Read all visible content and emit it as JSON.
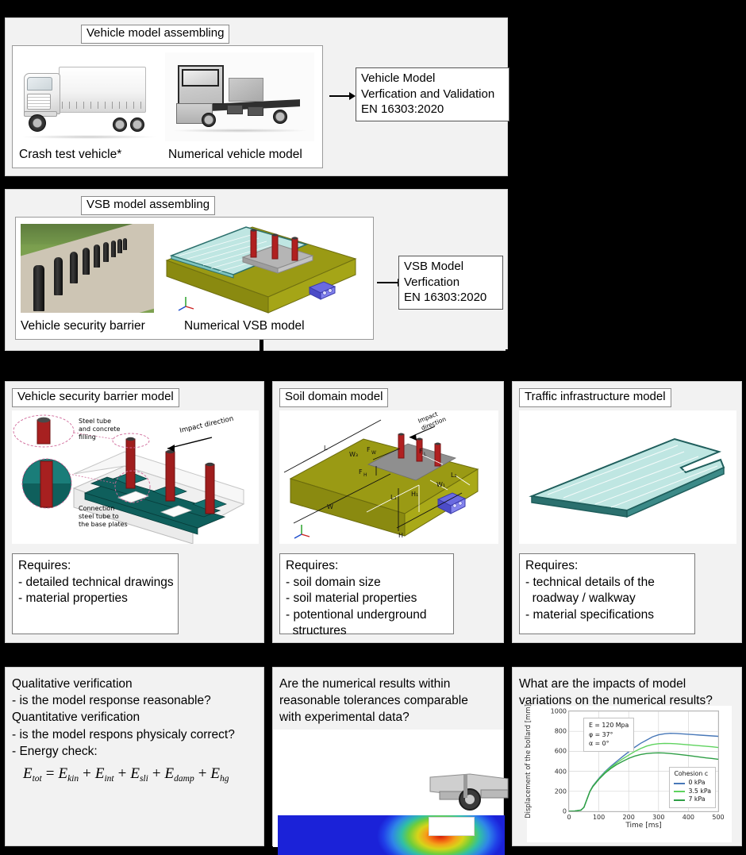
{
  "row1": {
    "title": "Vehicle model assembling",
    "captions": [
      "Crash test vehicle*",
      "Numerical vehicle model"
    ],
    "result_box": [
      "Vehicle Model",
      "Verfication and Validation",
      "EN 16303:2020"
    ]
  },
  "row2": {
    "title": "VSB model assembling",
    "captions": [
      "Vehicle security barrier",
      "Numerical VSB model"
    ],
    "result_box": [
      "VSB Model",
      "Verfication",
      "EN 16303:2020"
    ]
  },
  "row3": {
    "vsb_model": {
      "title": "Vehicle security barrier model",
      "annotations": {
        "detail_1": "Steel tube\nand concrete\nfilling",
        "detail_2": "Connection\nsteel tube to\nthe base plates",
        "impact": "Impact direction"
      },
      "requires_heading": "Requires:",
      "requires": [
        "- detailed technical drawings",
        "- material properties"
      ]
    },
    "soil_model": {
      "title": "Soil domain model",
      "dimension_labels": [
        "L",
        "W",
        "H",
        "L₁",
        "L₂",
        "W₁",
        "W₃",
        "H₁",
        "F_W",
        "F_H",
        "F_L"
      ],
      "annotations": {
        "impact": "Impact\ndirection"
      },
      "requires_heading": "Requires:",
      "requires": [
        "- soil domain size",
        "- soil material properties",
        "- potentional underground",
        "  structures"
      ]
    },
    "traffic_model": {
      "title": "Traffic infrastructure model",
      "requires_heading": "Requires:",
      "requires": [
        "- technical details of the",
        "  roadway / walkway",
        "- material specifications"
      ]
    }
  },
  "row4": {
    "qualitative": {
      "lines": [
        "Qualitative verification",
        "- is the model response reasonable?",
        "Quantitative verification",
        "- is the model respons physicaly correct?",
        "- Energy check:"
      ],
      "equation": {
        "lhs_base": "E",
        "lhs_sub": "tot",
        "terms": [
          {
            "base": "E",
            "sub": "kin"
          },
          {
            "base": "E",
            "sub": "int"
          },
          {
            "base": "E",
            "sub": "sli"
          },
          {
            "base": "E",
            "sub": "damp"
          },
          {
            "base": "E",
            "sub": "hg"
          }
        ],
        "equals": "=",
        "plus": "+"
      }
    },
    "tolerance": {
      "lines": [
        "Are the numerical results within",
        "reasonable tolerances comparable",
        "with experimental data?"
      ]
    },
    "variations": {
      "lines": [
        "What are the impacts of model",
        "variations on the numerical results?"
      ]
    }
  },
  "chart_data": {
    "type": "line",
    "title": "",
    "xlabel": "Time [ms]",
    "ylabel": "Displacement of the bollard [mm]",
    "xlim": [
      0,
      500
    ],
    "ylim": [
      0,
      1000
    ],
    "xticks": [
      0,
      100,
      200,
      300,
      400,
      500
    ],
    "yticks": [
      0,
      200,
      400,
      600,
      800,
      1000
    ],
    "grid": true,
    "legend_title": "Cohesion c",
    "legend_position": "lower right",
    "annotation": "E = 120 Mpa\nφ = 37°\nα = 0°",
    "x": [
      0,
      20,
      40,
      50,
      60,
      70,
      80,
      100,
      120,
      140,
      160,
      180,
      200,
      220,
      240,
      260,
      280,
      300,
      320,
      340,
      360,
      380,
      400,
      420,
      440,
      460,
      480,
      500
    ],
    "series": [
      {
        "name": "0 kPa",
        "color": "#4878b8",
        "values": [
          0,
          3,
          12,
          40,
          120,
          200,
          255,
          330,
          395,
          450,
          500,
          548,
          595,
          640,
          680,
          712,
          745,
          765,
          775,
          780,
          778,
          774,
          770,
          766,
          762,
          758,
          754,
          750
        ]
      },
      {
        "name": "3.5 kPa",
        "color": "#5fd35f",
        "values": [
          0,
          3,
          12,
          40,
          120,
          200,
          252,
          325,
          388,
          440,
          485,
          525,
          562,
          598,
          628,
          652,
          668,
          676,
          679,
          678,
          675,
          670,
          665,
          660,
          655,
          650,
          645,
          638
        ]
      },
      {
        "name": "7 kPa",
        "color": "#2e9e45",
        "values": [
          0,
          3,
          12,
          40,
          120,
          198,
          248,
          320,
          380,
          428,
          468,
          500,
          530,
          552,
          568,
          578,
          583,
          585,
          583,
          578,
          572,
          565,
          558,
          550,
          542,
          534,
          528,
          520
        ]
      }
    ]
  }
}
